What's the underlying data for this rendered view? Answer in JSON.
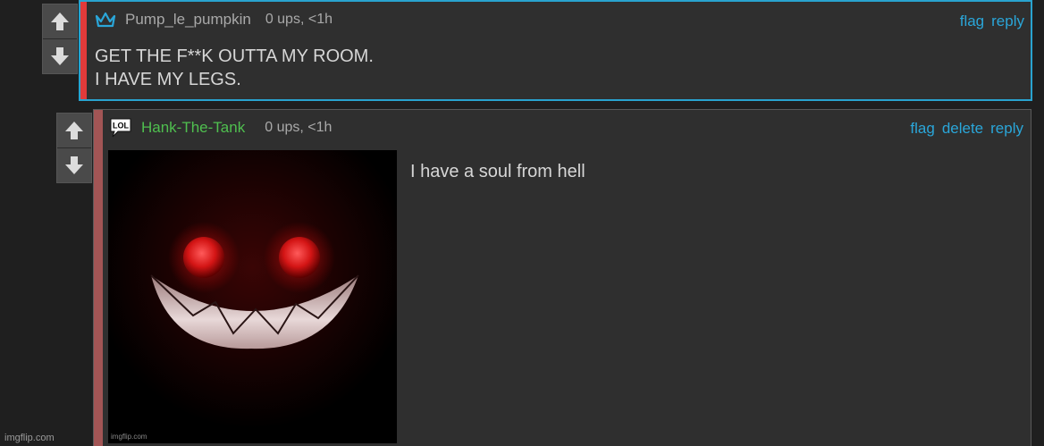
{
  "comment1": {
    "username": "Pump_le_pumpkin",
    "meta": "0 ups, <1h",
    "body": [
      "GET THE F**K OUTTA MY ROOM.",
      "I HAVE MY LEGS."
    ],
    "actions": [
      "flag",
      "reply"
    ],
    "badge_icon": "crown-icon"
  },
  "comment2": {
    "username": "Hank-The-Tank",
    "meta": "0 ups, <1h",
    "body": "I have a soul from hell",
    "actions": [
      "flag",
      "delete",
      "reply"
    ],
    "badge_icon": "lol-speech-icon",
    "badge_text": "LOL",
    "image_watermark": "imgflip.com"
  },
  "footer_watermark": "imgflip.com",
  "colors": {
    "link": "#2aa6d9",
    "highlight_border": "#29a3cf",
    "stripe1": "#e23a3a",
    "stripe2": "#a25555",
    "username2": "#4fbf4f"
  }
}
